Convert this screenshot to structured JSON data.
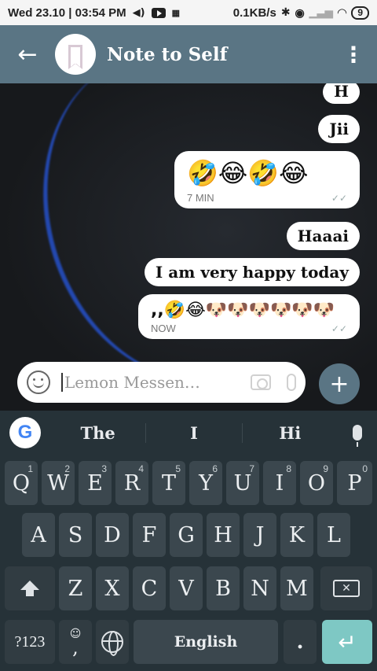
{
  "status_bar": {
    "datetime": "Wed 23.10 | 03:54 PM",
    "speed": "0.1KB/s",
    "battery": "9"
  },
  "header": {
    "title": "Note to Self"
  },
  "messages": [
    {
      "text": "H"
    },
    {
      "text": "Jii"
    },
    {
      "text": "🤣😂🤣😂",
      "time": "7 MIN"
    },
    {
      "text": "Haaai"
    },
    {
      "text": "I am very happy today"
    },
    {
      "text": ",,🤣😂🐶🐶🐶🐶🐶🐶",
      "time": "NOW"
    }
  ],
  "composer": {
    "placeholder": "Lemon Messen…"
  },
  "keyboard": {
    "suggestions": [
      "The",
      "I",
      "Hi"
    ],
    "row1": [
      {
        "label": "Q",
        "hint": "1"
      },
      {
        "label": "W",
        "hint": "2"
      },
      {
        "label": "E",
        "hint": "3"
      },
      {
        "label": "R",
        "hint": "4"
      },
      {
        "label": "T",
        "hint": "5"
      },
      {
        "label": "Y",
        "hint": "6"
      },
      {
        "label": "U",
        "hint": "7"
      },
      {
        "label": "I",
        "hint": "8"
      },
      {
        "label": "O",
        "hint": "9"
      },
      {
        "label": "P",
        "hint": "0"
      }
    ],
    "row2": [
      "A",
      "S",
      "D",
      "F",
      "G",
      "H",
      "J",
      "K",
      "L"
    ],
    "row3": [
      "Z",
      "X",
      "C",
      "V",
      "B",
      "N",
      "M"
    ],
    "symbols_label": "?123",
    "comma_label": ",",
    "space_label": "English",
    "period_label": "."
  },
  "colors": {
    "header": "#5a7584",
    "keyboard_bg": "#263238",
    "key_bg": "#3b474e",
    "enter": "#7ec8c4"
  }
}
